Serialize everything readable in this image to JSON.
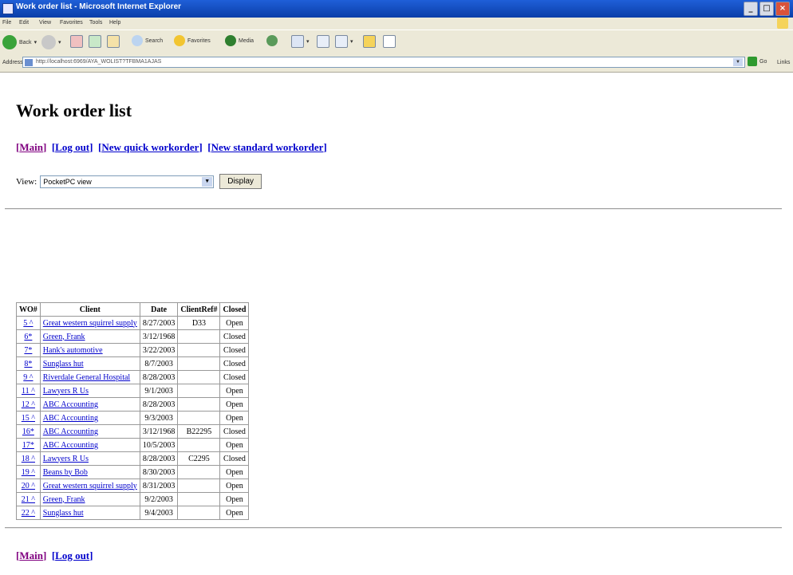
{
  "window": {
    "title": "Work order list - Microsoft Internet Explorer",
    "buttons": [
      "_",
      "□",
      "×"
    ]
  },
  "menu": [
    "File",
    "Edit",
    "View",
    "Favorites",
    "Tools",
    "Help"
  ],
  "toolbar": {
    "back": "Back",
    "search": "Search",
    "favorites": "Favorites",
    "media": "Media"
  },
  "address": {
    "label": "Address",
    "url": "http://localhost:6969/AYA_WOLIST?TFBMA1AJAS",
    "go": "Go",
    "links": "Links"
  },
  "page": {
    "title": "Work order list",
    "nav": {
      "main": "Main",
      "logout": "Log out",
      "new_quick": "New quick workorder",
      "new_standard": "New standard workorder"
    },
    "view_label": "View:",
    "view_value": "PocketPC view",
    "display_button": "Display",
    "table": {
      "headers": [
        "WO#",
        "Client",
        "Date",
        "ClientRef#",
        "Closed"
      ],
      "rows": [
        {
          "wo": "5 ^",
          "client": "Great western squirrel supply",
          "date": "8/27/2003",
          "ref": "D33",
          "closed": "Open"
        },
        {
          "wo": "6*",
          "client": "Green, Frank",
          "date": "3/12/1968",
          "ref": "",
          "closed": "Closed"
        },
        {
          "wo": "7*",
          "client": "Hank's automotive",
          "date": "3/22/2003",
          "ref": "",
          "closed": "Closed"
        },
        {
          "wo": "8*",
          "client": "Sunglass hut",
          "date": "8/7/2003",
          "ref": "",
          "closed": "Closed"
        },
        {
          "wo": "9 ^",
          "client": "Riverdale General Hospital",
          "date": "8/28/2003",
          "ref": "",
          "closed": "Closed"
        },
        {
          "wo": "11 ^",
          "client": "Lawyers R Us",
          "date": "9/1/2003",
          "ref": "",
          "closed": "Open"
        },
        {
          "wo": "12 ^",
          "client": "ABC Accounting",
          "date": "8/28/2003",
          "ref": "",
          "closed": "Open"
        },
        {
          "wo": "15 ^",
          "client": "ABC Accounting",
          "date": "9/3/2003",
          "ref": "",
          "closed": "Open"
        },
        {
          "wo": "16*",
          "client": "ABC Accounting",
          "date": "3/12/1968",
          "ref": "B22295",
          "closed": "Closed"
        },
        {
          "wo": "17*",
          "client": "ABC Accounting",
          "date": "10/5/2003",
          "ref": "",
          "closed": "Open"
        },
        {
          "wo": "18 ^",
          "client": "Lawyers R Us",
          "date": "8/28/2003",
          "ref": "C2295",
          "closed": "Closed"
        },
        {
          "wo": "19 ^",
          "client": "Beans by Bob",
          "date": "8/30/2003",
          "ref": "",
          "closed": "Open"
        },
        {
          "wo": "20 ^",
          "client": "Great western squirrel supply",
          "date": "8/31/2003",
          "ref": "",
          "closed": "Open"
        },
        {
          "wo": "21 ^",
          "client": "Green, Frank",
          "date": "9/2/2003",
          "ref": "",
          "closed": "Open"
        },
        {
          "wo": "22 ^",
          "client": "Sunglass hut",
          "date": "9/4/2003",
          "ref": "",
          "closed": "Open"
        }
      ]
    }
  },
  "colors": {
    "link": "#0000cc",
    "visited": "#800080",
    "chrome": "#ece9d8",
    "titlebar": "#0a3ea8"
  }
}
